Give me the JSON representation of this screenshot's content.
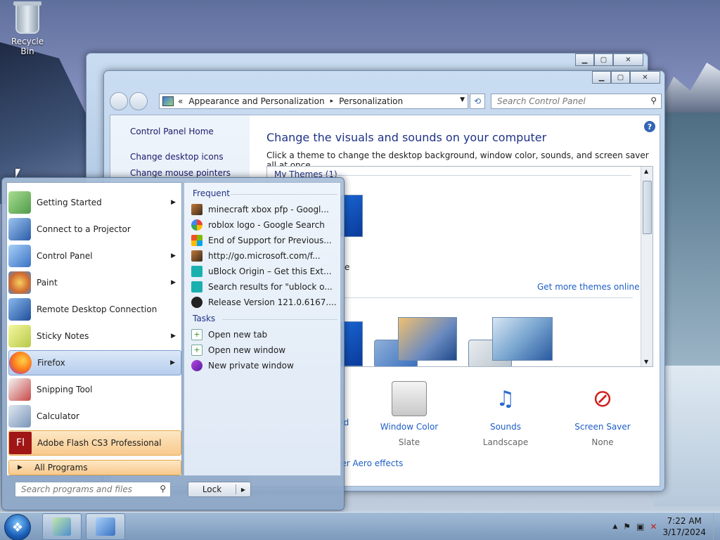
{
  "desktop": {
    "recycle_bin": "Recycle Bin"
  },
  "control_panel": {
    "address": {
      "prefix": "«",
      "crumb1": "Appearance and Personalization",
      "sep": "▸",
      "crumb2": "Personalization"
    },
    "search_placeholder": "Search Control Panel",
    "sidebar": [
      "Control Panel Home",
      "Change desktop icons",
      "Change mouse pointers"
    ],
    "title": "Change the visuals and sounds on your computer",
    "subtitle": "Click a theme to change the desktop background, window color, sounds, and screen saver all at once.",
    "themes_header": "My Themes (1)",
    "theme_partial_label": "e",
    "get_more": "Get more themes online",
    "bottom": [
      {
        "partial": "nd"
      },
      {
        "label": "Window Color",
        "value": "Slate"
      },
      {
        "label": "Sounds",
        "value": "Landscape"
      },
      {
        "label": "Screen Saver",
        "value": "None"
      }
    ],
    "aero_link": "blems with transparency and other Aero effects"
  },
  "start_menu": {
    "programs": [
      {
        "label": "Getting Started",
        "arrow": true,
        "icon": "getting-started-icon",
        "color": "#7bbf6a"
      },
      {
        "label": "Connect to a Projector",
        "arrow": false,
        "icon": "projector-icon",
        "color": "#4a7fc8"
      },
      {
        "label": "Control Panel",
        "arrow": true,
        "icon": "control-panel-icon",
        "color": "#4d8fd6"
      },
      {
        "label": "Paint",
        "arrow": true,
        "icon": "paint-icon",
        "color": "#e6a43a"
      },
      {
        "label": "Remote Desktop Connection",
        "arrow": false,
        "icon": "remote-desktop-icon",
        "color": "#3a73c4"
      },
      {
        "label": "Sticky Notes",
        "arrow": true,
        "icon": "sticky-notes-icon",
        "color": "#d9e46a"
      },
      {
        "label": "Firefox",
        "arrow": true,
        "icon": "firefox-icon",
        "color": "#f07a2a"
      },
      {
        "label": "Snipping Tool",
        "arrow": false,
        "icon": "snipping-tool-icon",
        "color": "#c84848"
      },
      {
        "label": "Calculator",
        "arrow": false,
        "icon": "calculator-icon",
        "color": "#7a95b8"
      },
      {
        "label": "Adobe Flash CS3 Professional",
        "arrow": false,
        "icon": "flash-icon",
        "color": "#a01616",
        "icon_text": "Fl"
      }
    ],
    "all_programs": "All Programs",
    "frequent_header": "Frequent",
    "frequent": [
      {
        "label": "minecraft xbox pfp - Googl...",
        "icon": "firefox-page-icon",
        "color": "#8a4a2a"
      },
      {
        "label": "roblox logo - Google Search",
        "icon": "google-icon",
        "color": "#4285f4"
      },
      {
        "label": "End of Support for Previous...",
        "icon": "microsoft-icon",
        "color": "#f25022"
      },
      {
        "label": "http://go.microsoft.com/f...",
        "icon": "firefox-page-icon",
        "color": "#8a4a2a"
      },
      {
        "label": "uBlock Origin – Get this Ext...",
        "icon": "puzzle-icon",
        "color": "#1ab0b0"
      },
      {
        "label": "Search results for \"ublock o...",
        "icon": "puzzle-icon",
        "color": "#1ab0b0"
      },
      {
        "label": "Release Version 121.0.6167....",
        "icon": "github-icon",
        "color": "#222222"
      }
    ],
    "tasks_header": "Tasks",
    "tasks": [
      {
        "label": "Open new tab",
        "icon": "new-tab-icon"
      },
      {
        "label": "Open new window",
        "icon": "new-window-icon"
      },
      {
        "label": "New private window",
        "icon": "private-window-icon"
      }
    ],
    "search_placeholder": "Search programs and files",
    "lock_label": "Lock"
  },
  "taskbar": {
    "time": "7:22 AM",
    "date": "3/17/2024"
  }
}
